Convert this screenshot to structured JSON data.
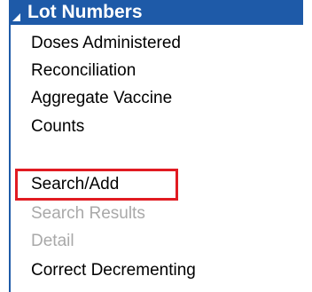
{
  "menu": {
    "header": "Lot Numbers",
    "items": [
      {
        "label": "Doses Administered",
        "state": "enabled"
      },
      {
        "label": "Reconciliation",
        "state": "enabled"
      },
      {
        "label": "Aggregate Vaccine",
        "state": "enabled"
      },
      {
        "label": "Counts",
        "state": "enabled"
      },
      {
        "label": "Search/Add",
        "state": "enabled",
        "highlighted": true
      },
      {
        "label": "Search Results",
        "state": "disabled"
      },
      {
        "label": "Detail",
        "state": "disabled"
      },
      {
        "label": "Correct Decrementing",
        "state": "enabled"
      }
    ]
  },
  "colors": {
    "header_bg": "#1e5aa8",
    "header_text": "#ffffff",
    "item_text": "#000000",
    "disabled_text": "#a9a9a9",
    "highlight_border": "#e11b22"
  },
  "icons": {
    "header_expand": "triangle-expanded-icon"
  }
}
